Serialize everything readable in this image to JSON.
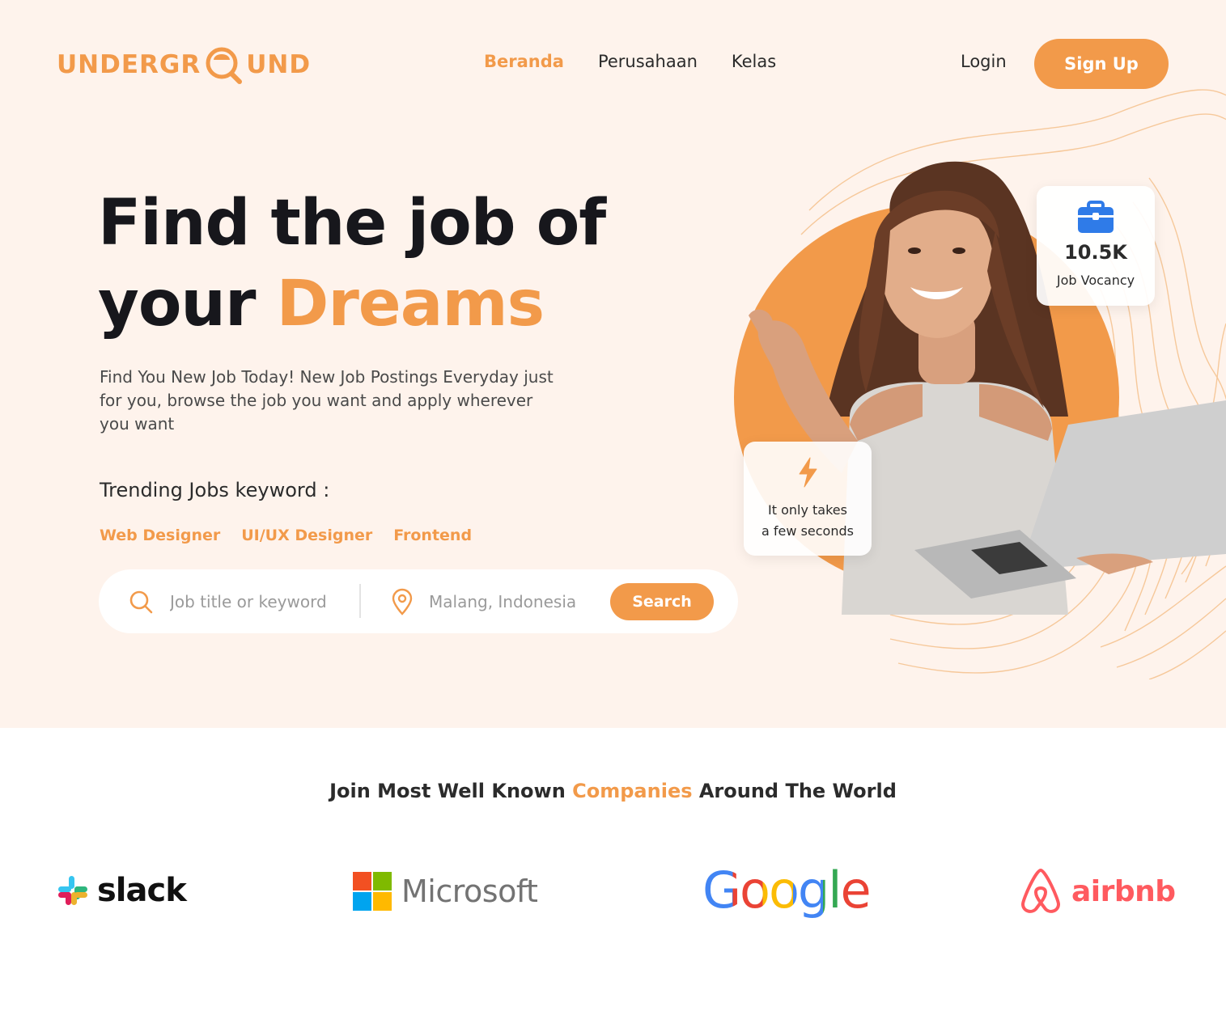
{
  "brand": {
    "logo_prefix": "UNDERGR",
    "logo_suffix": "UND",
    "accent_color": "#f29a4a",
    "hero_bg_color": "#fef3ec"
  },
  "nav": {
    "items": [
      {
        "label": "Beranda",
        "active": true
      },
      {
        "label": "Perusahaan",
        "active": false
      },
      {
        "label": "Kelas",
        "active": false
      }
    ],
    "login_label": "Login",
    "signup_label": "Sign Up"
  },
  "hero": {
    "headline_line1": "Find the job of",
    "headline_line2_plain": "your ",
    "headline_line2_accent": "Dreams",
    "subtitle": "Find You New Job Today! New Job Postings Everyday just for you, browse the job you want and apply wherever you want",
    "trending_title": "Trending Jobs keyword :",
    "trending_tags": [
      "Web Designer",
      "UI/UX Designer",
      "Frontend"
    ]
  },
  "search": {
    "keyword_placeholder": "Job title or keyword",
    "location_placeholder": "Malang, Indonesia",
    "button_label": "Search",
    "icons": [
      "search-icon",
      "location-pin-icon"
    ]
  },
  "stats": {
    "vacancy_count": "10.5K",
    "vacancy_label": "Job Vocancy",
    "vacancy_icon": "briefcase-icon",
    "fast_line1": "It only takes",
    "fast_line2": "a few seconds",
    "fast_icon": "lightning-bolt-icon"
  },
  "companies": {
    "title_plain_1": "Join Most Well Known ",
    "title_accent": "Companies",
    "title_plain_2": " Around The World",
    "logos": [
      {
        "name": "slack",
        "icon": "slack-logo"
      },
      {
        "name": "Microsoft",
        "icon": "microsoft-logo"
      },
      {
        "name": "Google",
        "icon": "google-logo"
      },
      {
        "name": "airbnb",
        "icon": "airbnb-logo"
      }
    ]
  }
}
